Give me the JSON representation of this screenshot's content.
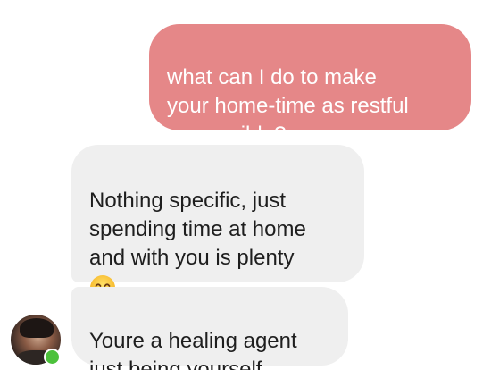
{
  "conversation": {
    "messages": [
      {
        "sender": "me",
        "text": "what can I do to make\nyour home-time as restful\nas possible?"
      },
      {
        "sender": "them",
        "text": "Nothing specific, just\nspending time at home\nand with you is plenty",
        "emoji": "smiling-face-with-smiling-eyes"
      },
      {
        "sender": "them",
        "text": "Youre a healing agent\njust being yourself"
      }
    ]
  },
  "contact": {
    "online": true
  },
  "colors": {
    "sent_bubble": "#e58788",
    "received_bubble": "#efefef",
    "online_indicator": "#4cc13b"
  }
}
